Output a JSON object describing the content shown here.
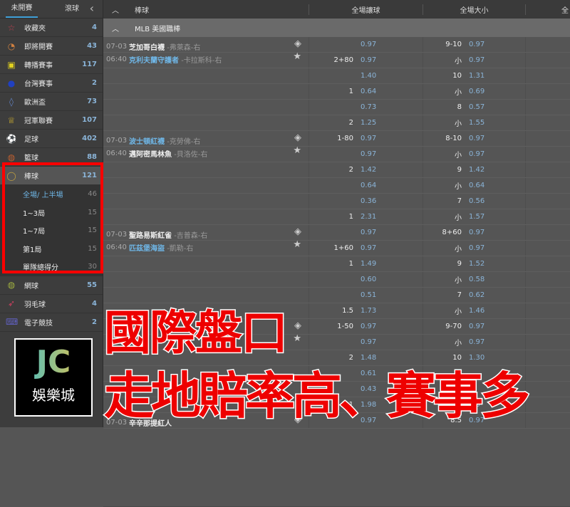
{
  "sidebar": {
    "tabs": [
      "未開賽",
      "滾球"
    ],
    "items": [
      {
        "label": "收藏夾",
        "count": "4",
        "icon": "star-icon",
        "color": "#c04050"
      },
      {
        "label": "即將開賽",
        "count": "43",
        "icon": "clock-icon",
        "color": "#d08040"
      },
      {
        "label": "轉播賽事",
        "count": "117",
        "icon": "tv-icon",
        "color": "#e0d020"
      },
      {
        "label": "台灣賽事",
        "count": "2",
        "icon": "taiwan-flag-icon",
        "color": "#2040c0"
      },
      {
        "label": "歐洲盃",
        "count": "73",
        "icon": "trophy-icon",
        "color": "#6080c0"
      },
      {
        "label": "冠軍聯賽",
        "count": "107",
        "icon": "crown-icon",
        "color": "#d0b030"
      },
      {
        "label": "足球",
        "count": "402",
        "icon": "soccer-icon",
        "color": "#40a060"
      },
      {
        "label": "籃球",
        "count": "88",
        "icon": "basketball-icon",
        "color": "#c06030"
      },
      {
        "label": "棒球",
        "count": "121",
        "icon": "baseball-icon",
        "color": "#c0a040"
      }
    ],
    "subitems": [
      {
        "label": "全場/ 上半場",
        "count": "46"
      },
      {
        "label": "1~3局",
        "count": "15"
      },
      {
        "label": "1~7局",
        "count": "15"
      },
      {
        "label": "第1局",
        "count": "15"
      },
      {
        "label": "單隊總得分",
        "count": "30"
      }
    ],
    "items2": [
      {
        "label": "網球",
        "count": "55",
        "icon": "tennis-icon",
        "color": "#a0b040"
      },
      {
        "label": "羽毛球",
        "count": "4",
        "icon": "badminton-icon",
        "color": "#d04060"
      },
      {
        "label": "電子競技",
        "count": "2",
        "icon": "gamepad-icon",
        "color": "#6060c0"
      }
    ]
  },
  "header": {
    "sport": "棒球",
    "col1": "全場讓球",
    "col2": "全場大小",
    "col3": "全"
  },
  "league": "MLB 美國職棒",
  "matches": [
    {
      "date": "07-03",
      "time": "06:40",
      "home": "芝加哥白襪",
      "home_p": "-弗萊森-右",
      "away": "克利夫蘭守護者",
      "away_p": "-卡拉斯科-右",
      "away_hl": true,
      "rows": [
        [
          "",
          "0.97",
          "9-10",
          "0.97"
        ],
        [
          "2+80",
          "0.97",
          "小",
          "0.97"
        ],
        [
          "",
          "1.40",
          "10",
          "1.31"
        ],
        [
          "1",
          "0.64",
          "小",
          "0.69"
        ],
        [
          "",
          "0.73",
          "8",
          "0.57"
        ],
        [
          "2",
          "1.25",
          "小",
          "1.55"
        ]
      ]
    },
    {
      "date": "07-03",
      "time": "06:40",
      "home": "波士頓紅襪",
      "home_p": "-克勞佛-右",
      "away": "邁阿密馬林魚",
      "away_p": "-貝洛佐-右",
      "home_hl": true,
      "rows": [
        [
          "1-80",
          "0.97",
          "8-10",
          "0.97"
        ],
        [
          "",
          "0.97",
          "小",
          "0.97"
        ],
        [
          "2",
          "1.42",
          "9",
          "1.42"
        ],
        [
          "",
          "0.64",
          "小",
          "0.64"
        ],
        [
          "",
          "0.36",
          "7",
          "0.56"
        ],
        [
          "1",
          "2.31",
          "小",
          "1.57"
        ]
      ]
    },
    {
      "date": "07-03",
      "time": "06:40",
      "home": "聖路易斯紅雀",
      "home_p": "-吉普森-右",
      "away": "匹茲堡海盜",
      "away_p": "-凱勒-右",
      "away_hl": true,
      "rows": [
        [
          "",
          "0.97",
          "8+60",
          "0.97"
        ],
        [
          "1+60",
          "0.97",
          "小",
          "0.97"
        ],
        [
          "1",
          "1.49",
          "9",
          "1.52"
        ],
        [
          "",
          "0.60",
          "小",
          "0.58"
        ],
        [
          "",
          "0.51",
          "7",
          "0.62"
        ],
        [
          "1.5",
          "1.73",
          "小",
          "1.46"
        ]
      ]
    },
    {
      "date": "",
      "time": "",
      "home": "",
      "home_p": "",
      "away": "",
      "away_p": "",
      "rows": [
        [
          "1-50",
          "0.97",
          "9-70",
          "0.97"
        ],
        [
          "",
          "0.97",
          "小",
          "0.97"
        ],
        [
          "2",
          "1.48",
          "10",
          "1.30"
        ],
        [
          "",
          "0.61",
          "",
          ""
        ],
        [
          "",
          "0.43",
          "",
          ""
        ],
        [
          "1",
          "1.98",
          "小",
          "1.5"
        ]
      ]
    },
    {
      "date": "07-03",
      "time": "",
      "home": "辛辛那提紅人",
      "home_p": "",
      "away": "",
      "away_p": "",
      "rows": [
        [
          "",
          "0.97",
          "8.5",
          "0.97"
        ]
      ]
    }
  ],
  "overlay": {
    "line1": "國際盤口",
    "line2": "走地賠率高、賽事多"
  },
  "logo": {
    "mark": "JC",
    "name": "娛樂城"
  }
}
